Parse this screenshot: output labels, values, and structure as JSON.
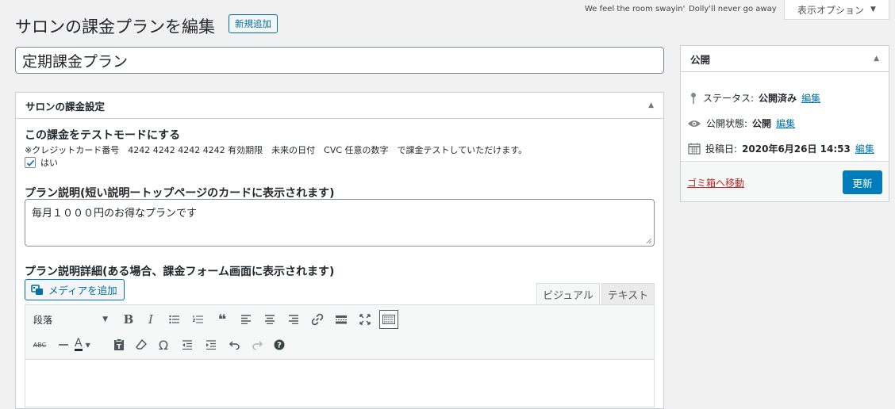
{
  "header": {
    "lyric_1": "We feel the room swayin'",
    "lyric_2": "Dolly'll never go away",
    "screen_options": "表示オプション"
  },
  "page": {
    "title": "サロンの課金プランを編集",
    "add_new": "新規追加",
    "post_title": "定期課金プラン"
  },
  "settings_box": {
    "title": "サロンの課金設定",
    "test_mode_label": "この課金をテストモードにする",
    "test_mode_note": "※クレジットカード番号　4242 4242 4242 4242 有効期限　未来の日付　CVC 任意の数字　で課金テストしていただけます。",
    "test_mode_checkbox": "はい",
    "test_mode_checked": true,
    "short_desc_label": "プラン説明(短い説明ートップページのカードに表示されます)",
    "short_desc_value": "毎月１０００円のお得なプランです",
    "detail_desc_label": "プラン説明詳細(ある場合、課金フォーム画面に表示されます)",
    "add_media": "メディアを追加",
    "tab_visual": "ビジュアル",
    "tab_text": "テキスト",
    "format_select": "段落"
  },
  "toolbar_icons": [
    "bold-icon",
    "italic-icon",
    "bullet-list-icon",
    "numbered-list-icon",
    "blockquote-icon",
    "align-left-icon",
    "align-center-icon",
    "align-right-icon",
    "link-icon",
    "read-more-icon",
    "fullscreen-icon",
    "toolbar-toggle-icon",
    "strikethrough-icon",
    "horizontal-line-icon",
    "text-color-icon",
    "paste-text-icon",
    "clear-formatting-icon",
    "special-character-icon",
    "outdent-icon",
    "indent-icon",
    "undo-icon",
    "redo-icon",
    "help-icon"
  ],
  "publish_box": {
    "title": "公開",
    "status_label": "ステータス:",
    "status_value": "公開済み",
    "visibility_label": "公開状態:",
    "visibility_value": "公開",
    "date_label": "投稿日:",
    "date_value": "2020年6月26日 14:53",
    "edit_link": "編集",
    "trash_link": "ゴミ箱へ移動",
    "update_button": "更新"
  },
  "colors": {
    "primary": "#007cba",
    "link": "#0073aa",
    "trash": "#b32d2e",
    "background": "#f1f1f1"
  }
}
